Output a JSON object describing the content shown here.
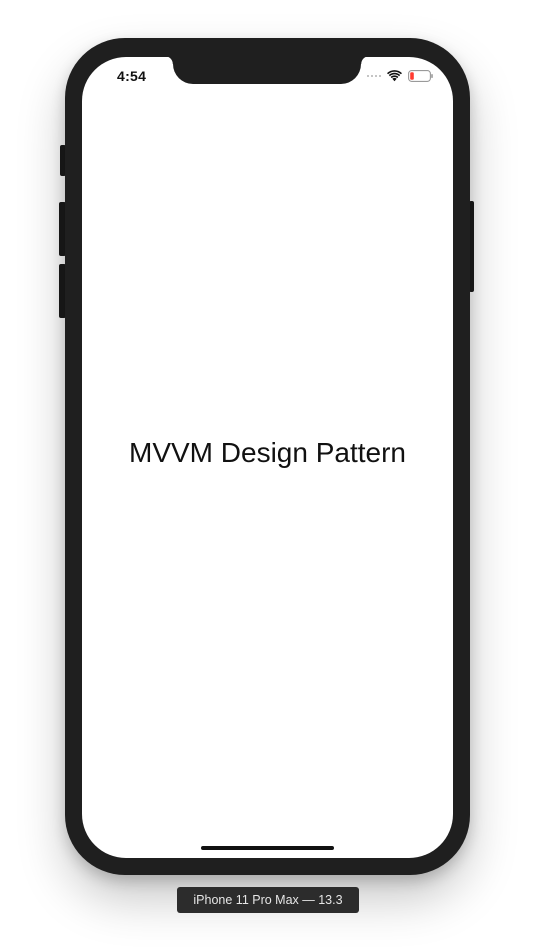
{
  "status_bar": {
    "time": "4:54",
    "icons": [
      "cellular-signal-icon",
      "wifi-icon",
      "battery-low-icon"
    ],
    "battery_color": "#ff3b30"
  },
  "app": {
    "title": "MVVM Design Pattern"
  },
  "simulator": {
    "device_label": "iPhone 11 Pro Max — 13.3"
  },
  "colors": {
    "bezel": "#1f1f1f",
    "screen_background": "#ffffff",
    "text": "#111111",
    "label_background": "#2c2c2c"
  }
}
